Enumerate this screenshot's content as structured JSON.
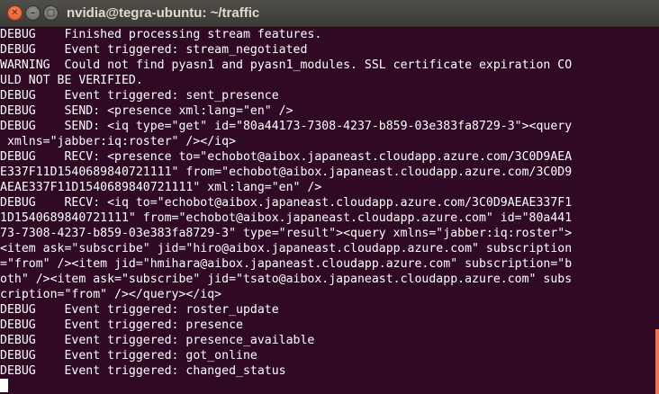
{
  "window": {
    "title": "nvidia@tegra-ubuntu: ~/traffic",
    "close_glyph": "✕",
    "minimize_glyph": "–",
    "maximize_glyph": "□"
  },
  "terminal": {
    "lines": [
      "DEBUG    Finished processing stream features.",
      "DEBUG    Event triggered: stream_negotiated",
      "WARNING  Could not find pyasn1 and pyasn1_modules. SSL certificate expiration CO",
      "ULD NOT BE VERIFIED.",
      "DEBUG    Event triggered: sent_presence",
      "DEBUG    SEND: <presence xml:lang=\"en\" />",
      "DEBUG    SEND: <iq type=\"get\" id=\"80a44173-7308-4237-b859-03e383fa8729-3\"><query",
      " xmlns=\"jabber:iq:roster\" /></iq>",
      "DEBUG    RECV: <presence to=\"echobot@aibox.japaneast.cloudapp.azure.com/3C0D9AEA",
      "E337F11D1540689840721111\" from=\"echobot@aibox.japaneast.cloudapp.azure.com/3C0D9",
      "AEAE337F11D1540689840721111\" xml:lang=\"en\" />",
      "DEBUG    RECV: <iq to=\"echobot@aibox.japaneast.cloudapp.azure.com/3C0D9AEAE337F1",
      "1D1540689840721111\" from=\"echobot@aibox.japaneast.cloudapp.azure.com\" id=\"80a441",
      "73-7308-4237-b859-03e383fa8729-3\" type=\"result\"><query xmlns=\"jabber:iq:roster\">",
      "<item ask=\"subscribe\" jid=\"hiro@aibox.japaneast.cloudapp.azure.com\" subscription",
      "=\"from\" /><item jid=\"hmihara@aibox.japaneast.cloudapp.azure.com\" subscription=\"b",
      "oth\" /><item ask=\"subscribe\" jid=\"tsato@aibox.japaneast.cloudapp.azure.com\" subs",
      "cription=\"from\" /></query></iq>",
      "DEBUG    Event triggered: roster_update",
      "DEBUG    Event triggered: presence",
      "DEBUG    Event triggered: presence_available",
      "DEBUG    Event triggered: got_online",
      "DEBUG    Event triggered: changed_status"
    ]
  },
  "colors": {
    "terminal_bg": "#300a24",
    "text": "#ffffff",
    "titlebar": "#3c3b37",
    "close_button": "#f07746",
    "scrollbar": "#f07746"
  }
}
